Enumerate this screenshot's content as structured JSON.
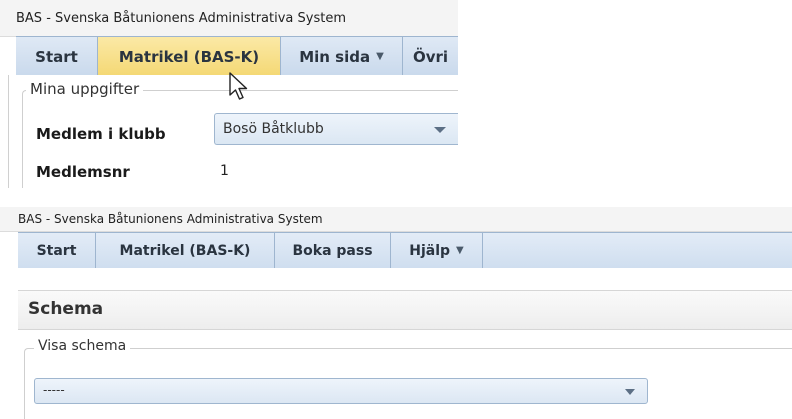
{
  "screen1": {
    "app_title": "BAS - Svenska Båtunionens Administrativa System",
    "menu": [
      {
        "label": "Start"
      },
      {
        "label": "Matrikel (BAS-K)"
      },
      {
        "label": "Min sida"
      },
      {
        "label": "Övri"
      }
    ],
    "fieldset_legend": "Mina uppgifter",
    "form": {
      "club_label": "Medlem i klubb",
      "club_value": "Bosö Båtklubb",
      "member_no_label": "Medlemsnr",
      "member_no_value": "1"
    }
  },
  "screen2": {
    "app_title": "BAS - Svenska Båtunionens Administrativa System",
    "menu": [
      {
        "label": "Start"
      },
      {
        "label": "Matrikel (BAS-K)"
      },
      {
        "label": "Boka pass"
      },
      {
        "label": "Hjälp"
      }
    ],
    "page_title": "Schema",
    "fieldset_legend": "Visa schema",
    "select_value": "-----"
  },
  "colors": {
    "menubar": "#cfdeef",
    "active_menu": "#f4d874",
    "border": "#9eb5cf"
  },
  "icons": [
    "chevron-down-icon",
    "mouse-pointer-icon"
  ]
}
